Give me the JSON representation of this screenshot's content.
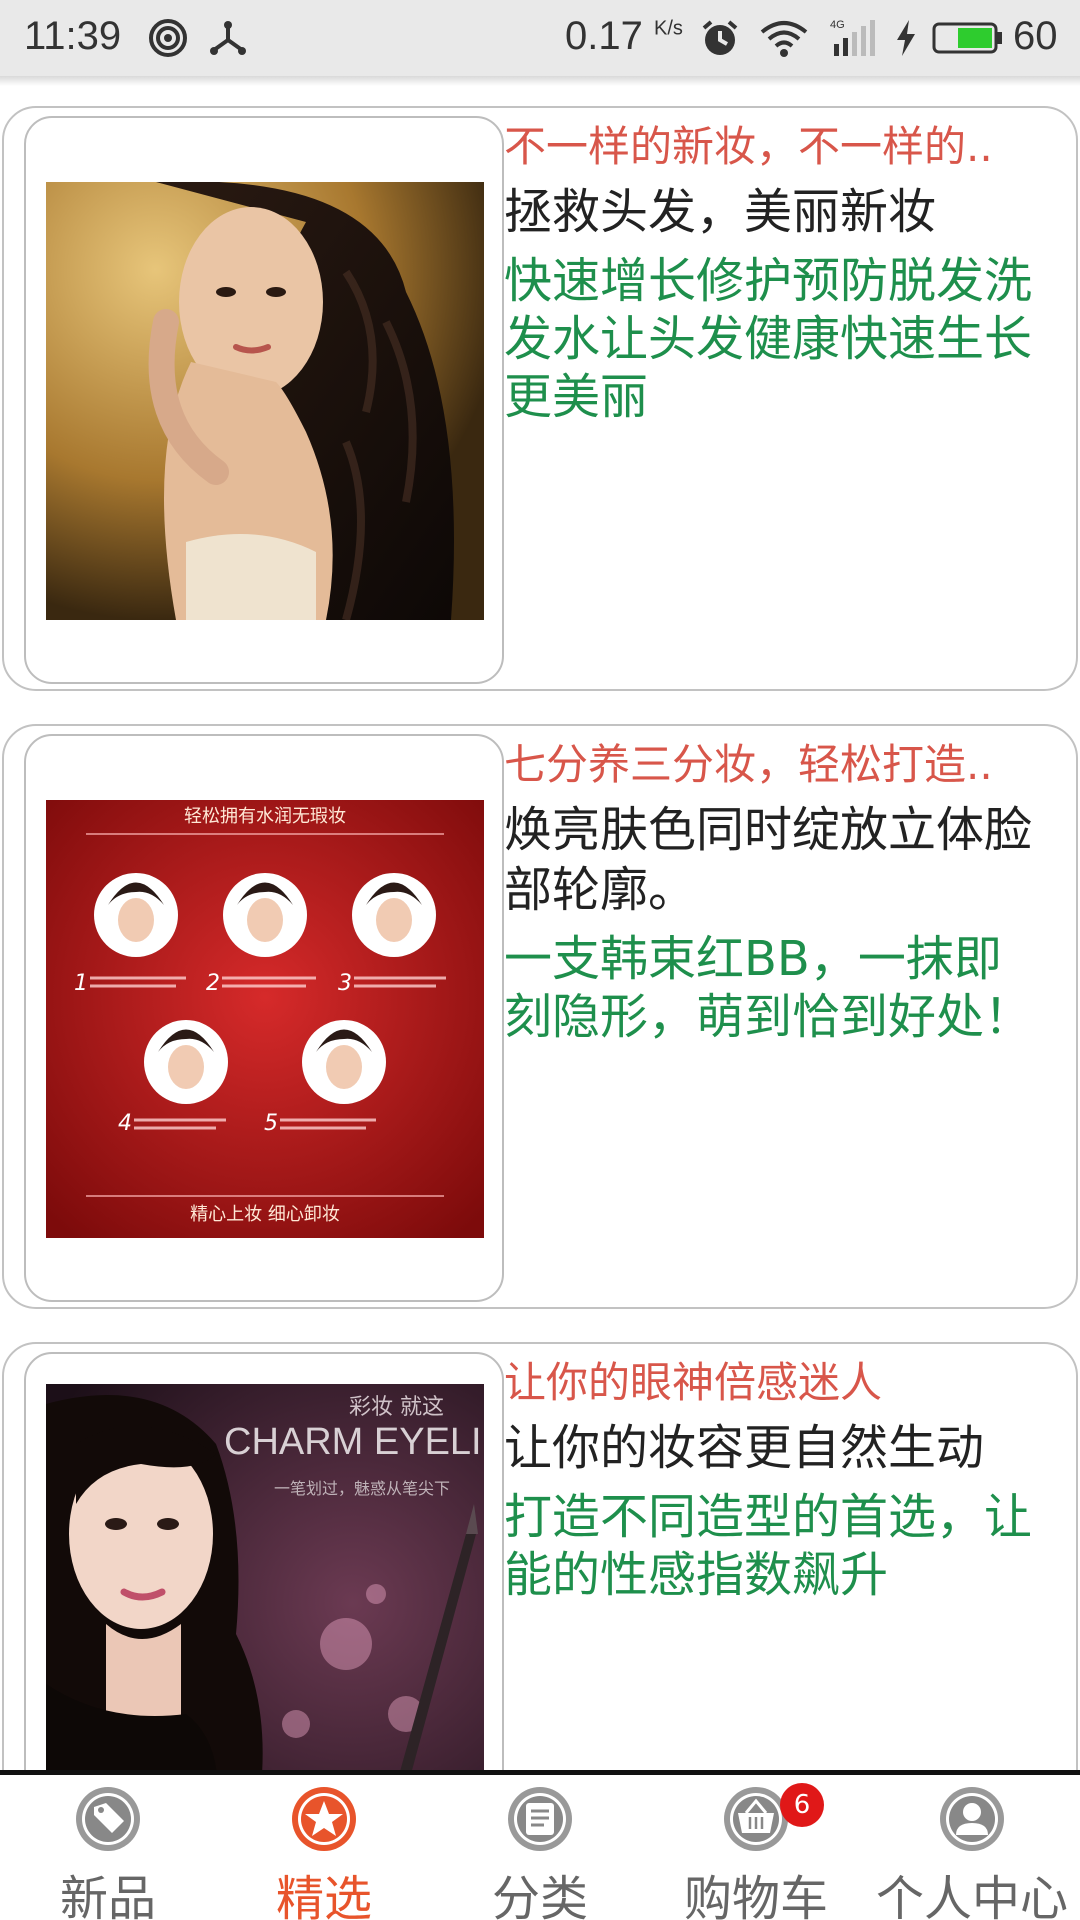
{
  "status_bar": {
    "time": "11:39",
    "speed_value": "0.17",
    "speed_unit": "K/s",
    "battery": "60",
    "signal_type": "4G"
  },
  "feed": {
    "items": [
      {
        "title": "不一样的新妆，不一样的..",
        "subtitle": "拯救头发，美丽新妆",
        "description": "快速增长修护预防脱发洗发水让头发健康快速生长更美丽"
      },
      {
        "title": "七分养三分妆，轻松打造..",
        "subtitle": "焕亮肤色同时绽放立体脸部轮廓。",
        "description": "一支韩束红BB，一抹即刻隐形，萌到恰到好处！",
        "image_text": {
          "header": "轻松拥有水润无瑕妆",
          "footer": "精心上妆 细心卸妆",
          "steps": [
            "1",
            "2",
            "3",
            "4",
            "5"
          ]
        }
      },
      {
        "title": "让你的眼神倍感迷人",
        "subtitle": "让你的妆容更自然生动",
        "description": "打造不同造型的首选，让能的性感指数飙升",
        "image_text": {
          "top": "彩妆 就这",
          "brand": "CHARM EYELI",
          "slogan": "一笔划过，魅惑从笔尖下"
        }
      }
    ]
  },
  "bottom_nav": {
    "items": [
      {
        "label": "新品",
        "icon": "tag-icon"
      },
      {
        "label": "精选",
        "icon": "star-icon"
      },
      {
        "label": "分类",
        "icon": "list-icon"
      },
      {
        "label": "购物车",
        "icon": "cart-icon",
        "badge": "6"
      },
      {
        "label": "个人中心",
        "icon": "user-icon"
      }
    ],
    "active_index": 1
  },
  "colors": {
    "title": "#d8564a",
    "subtitle": "#222222",
    "description": "#1e8f4c",
    "nav_active": "#e8542b",
    "nav_inactive": "#666666",
    "badge": "#e01818"
  }
}
